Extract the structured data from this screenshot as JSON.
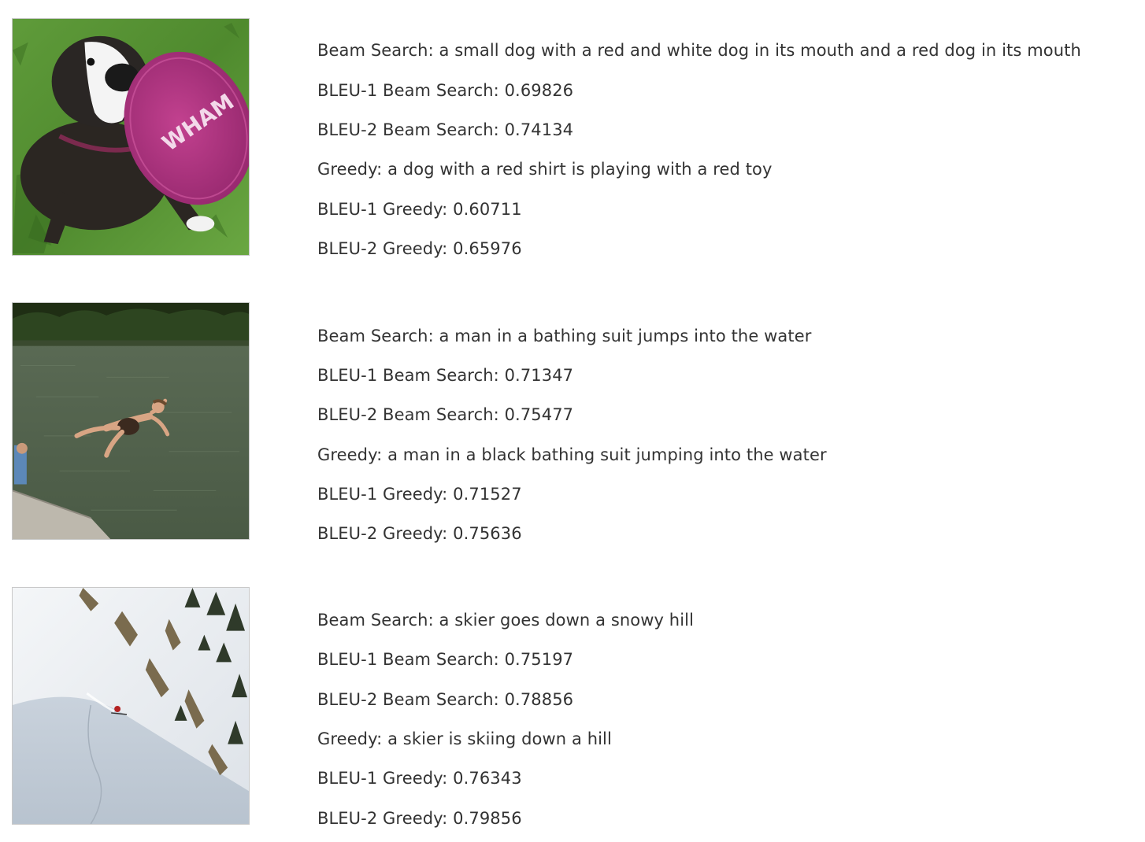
{
  "results": [
    {
      "image_icon": "dog-with-frisbee",
      "image_text": "WHAM",
      "beam_search": "Beam Search:  a small dog with a red and white dog in its mouth and a red dog in its mouth",
      "bleu1_beam": "BLEU-1 Beam Search: 0.69826",
      "bleu2_beam": "BLEU-2 Beam Search: 0.74134",
      "greedy": "Greedy:  a dog with a red shirt is playing with a red toy",
      "bleu1_greedy": "BLEU-1 Greedy: 0.60711",
      "bleu2_greedy": "BLEU-2 Greedy: 0.65976"
    },
    {
      "image_icon": "person-diving-into-water",
      "beam_search": "Beam Search:  a man in a bathing suit jumps into the water",
      "bleu1_beam": "BLEU-1 Beam Search: 0.71347",
      "bleu2_beam": "BLEU-2 Beam Search: 0.75477",
      "greedy": "Greedy:  a man in a black bathing suit jumping into the water",
      "bleu1_greedy": "BLEU-1 Greedy: 0.71527",
      "bleu2_greedy": "BLEU-2 Greedy: 0.75636"
    },
    {
      "image_icon": "skier-on-snowy-slope",
      "beam_search": "Beam Search:  a skier goes down a snowy hill",
      "bleu1_beam": "BLEU-1 Beam Search: 0.75197",
      "bleu2_beam": "BLEU-2 Beam Search: 0.78856",
      "greedy": "Greedy:  a skier is skiing down a hill",
      "bleu1_greedy": "BLEU-1 Greedy: 0.76343",
      "bleu2_greedy": "BLEU-2 Greedy: 0.79856"
    }
  ]
}
